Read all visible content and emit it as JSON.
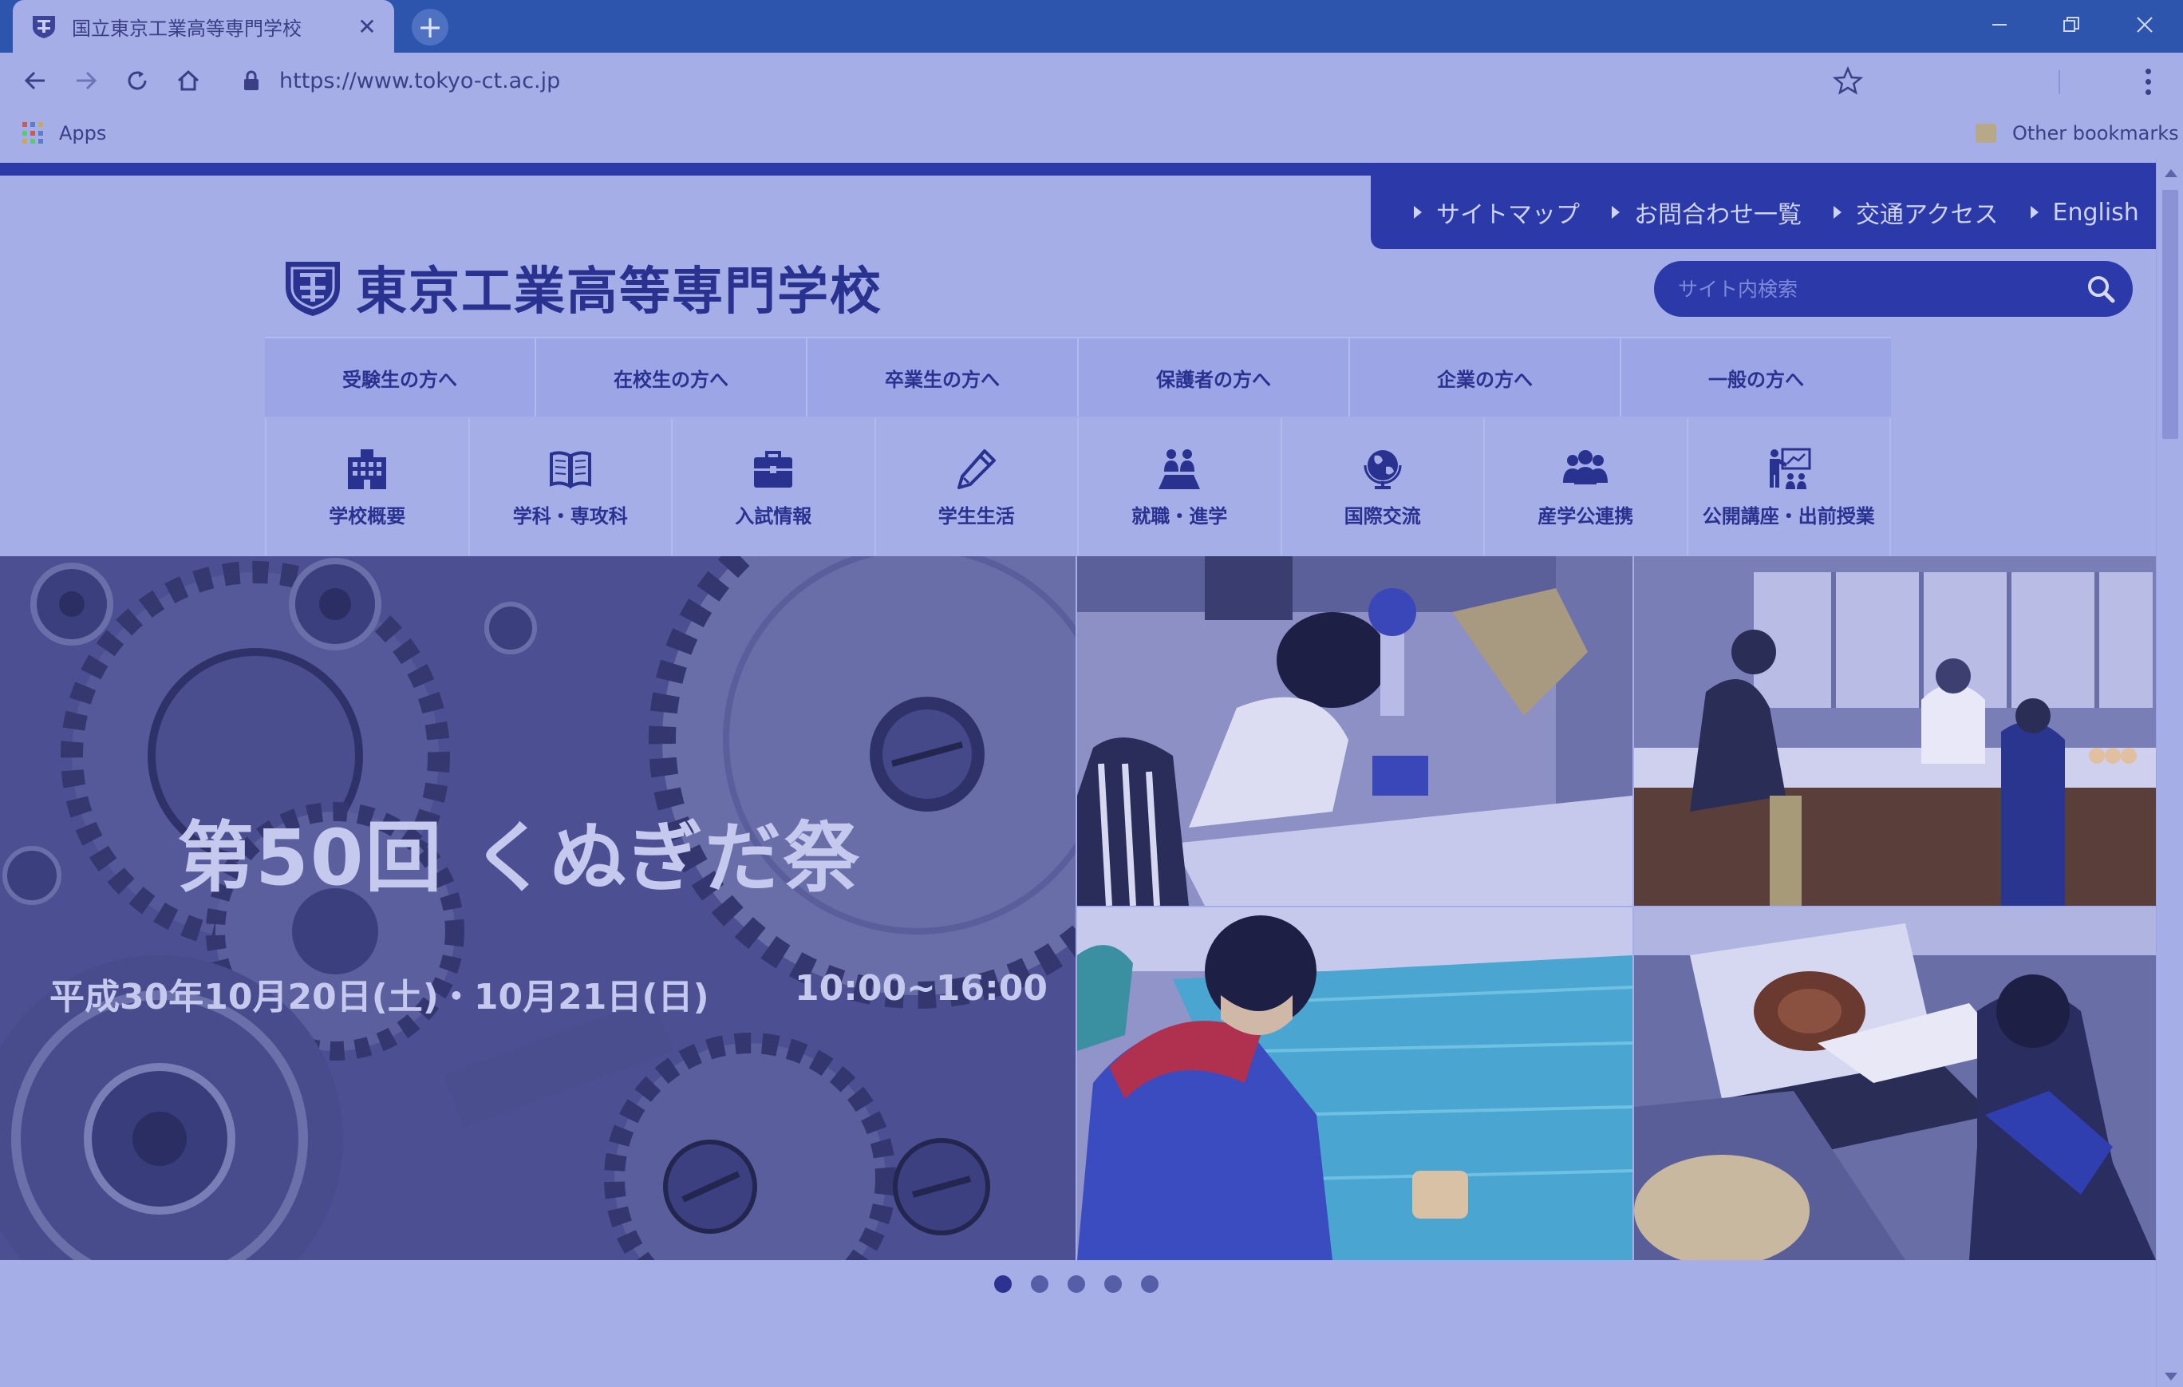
{
  "browser": {
    "tab_title": "国立東京工業高等専門学校",
    "new_tab_label": "+",
    "url": "https://www.tokyo-ct.ac.jp",
    "bookmarks": {
      "apps_label": "Apps",
      "other_label": "Other bookmarks"
    }
  },
  "site": {
    "utility_nav": [
      "サイトマップ",
      "お問合わせ一覧",
      "交通アクセス",
      "English"
    ],
    "school_name": "東京工業高等専門学校",
    "search_placeholder": "サイト内検索",
    "audience_nav": [
      "受験生の方へ",
      "在校生の方へ",
      "卒業生の方へ",
      "保護者の方へ",
      "企業の方へ",
      "一般の方へ"
    ],
    "category_nav": [
      {
        "label": "学校概要",
        "icon": "building-icon"
      },
      {
        "label": "学科・専攻科",
        "icon": "book-icon"
      },
      {
        "label": "入試情報",
        "icon": "briefcase-icon"
      },
      {
        "label": "学生生活",
        "icon": "pencil-icon"
      },
      {
        "label": "就職・進学",
        "icon": "people-icon"
      },
      {
        "label": "国際交流",
        "icon": "globe-icon"
      },
      {
        "label": "産学公連携",
        "icon": "group-icon"
      },
      {
        "label": "公開講座・出前授業",
        "icon": "lecture-icon"
      }
    ],
    "slider": {
      "title": "第50回 くぬぎだ祭",
      "dates": "平成30年10月20日(土)・10月21日(日)",
      "time": "10:00~16:00",
      "slide_count": 5,
      "active_slide": 1
    }
  },
  "colors": {
    "chrome_blue": "#2d55ae",
    "site_navy": "#2b3aa8",
    "overlay_lavender": "#a6aee8"
  }
}
